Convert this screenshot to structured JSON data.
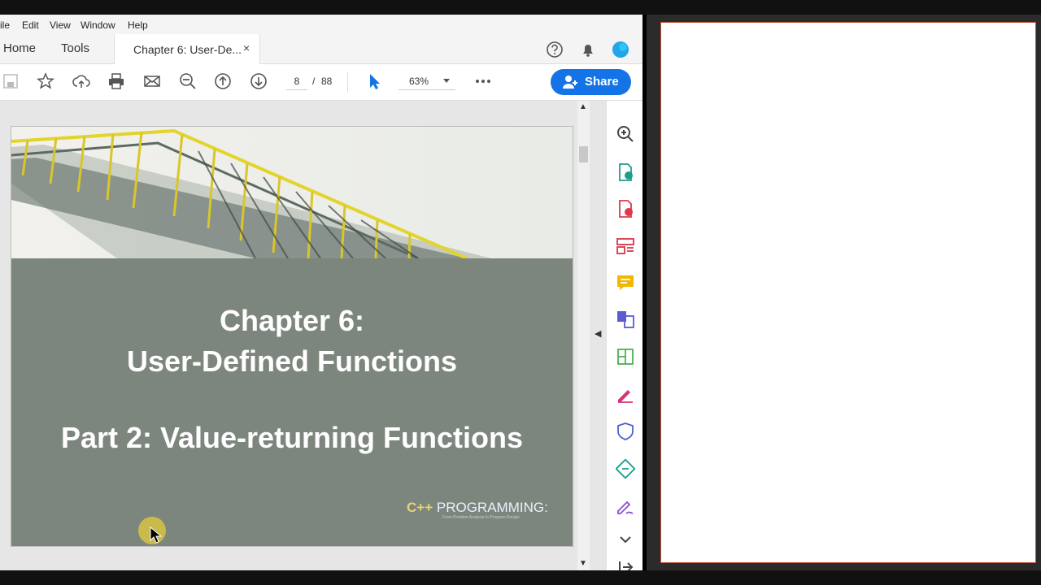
{
  "menu": {
    "file": "ile",
    "edit": "Edit",
    "view": "View",
    "window": "Window",
    "help": "Help"
  },
  "tabs": {
    "home": "Home",
    "tools": "Tools",
    "document": "Chapter 6: User-De...",
    "close": "×"
  },
  "toolbar": {
    "page_current": "8",
    "page_separator": "/",
    "page_total": "88",
    "zoom": "63%",
    "share_label": "Share"
  },
  "slide": {
    "title_line1": "Chapter 6:",
    "title_line2": "User-Defined Functions",
    "subtitle": "Part 2: Value-returning Functions",
    "logo_cpp": "C++",
    "logo_text": "PROGRAMMING:",
    "logo_tagline": "From Problem Analysis to Program Design"
  },
  "colors": {
    "accent": "#1473e6",
    "slide_bg": "#7d867d",
    "logo_yellow": "#e7d27a"
  }
}
